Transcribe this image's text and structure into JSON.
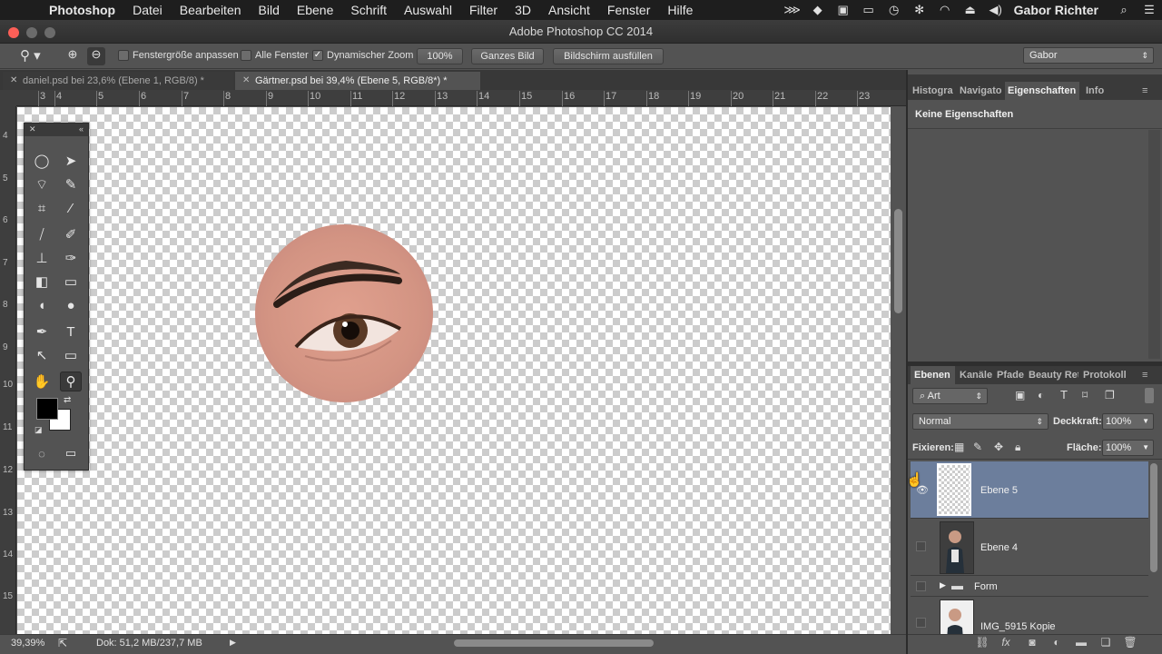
{
  "menubar": {
    "app": "Photoshop",
    "items": [
      "Datei",
      "Bearbeiten",
      "Bild",
      "Ebene",
      "Schrift",
      "Auswahl",
      "Filter",
      "3D",
      "Ansicht",
      "Fenster",
      "Hilfe"
    ],
    "user": "Gabor Richter"
  },
  "window": {
    "title": "Adobe Photoshop CC 2014"
  },
  "options": {
    "resize_windows": "Fenstergröße anpassen",
    "all_windows": "Alle Fenster",
    "scrubby_zoom": "Dynamischer Zoom",
    "zoom_value": "100%",
    "fit_screen": "Ganzes Bild",
    "fill_screen": "Bildschirm ausfüllen",
    "workspace": "Gabor"
  },
  "tabs": [
    {
      "label": "daniel.psd bei 23,6% (Ebene 1, RGB/8) *"
    },
    {
      "label": "Gärtner.psd bei 39,4% (Ebene 5, RGB/8*) *"
    }
  ],
  "rulers": {
    "top": [
      "3",
      "4",
      "5",
      "6",
      "7",
      "8",
      "9",
      "10",
      "11",
      "12",
      "13",
      "14",
      "15",
      "16",
      "17",
      "18",
      "19",
      "20",
      "21",
      "22",
      "23"
    ],
    "left": [
      "4",
      "5",
      "6",
      "7",
      "8",
      "9",
      "10",
      "11",
      "12",
      "13",
      "14",
      "15"
    ]
  },
  "status": {
    "zoom": "39,39%",
    "doc": "Dok: 51,2 MB/237,7 MB"
  },
  "properties_panel": {
    "tabs": [
      "Histogra",
      "Navigato",
      "Eigenschaften",
      "Info"
    ],
    "empty_text": "Keine Eigenschaften"
  },
  "layers_panel": {
    "tabs": [
      "Ebenen",
      "Kanäle",
      "Pfade",
      "Beauty Ret",
      "Protokoll"
    ],
    "filter_kind": "Art",
    "blend_mode": "Normal",
    "opacity_label": "Deckkraft:",
    "opacity": "100%",
    "lock_label": "Fixieren:",
    "fill_label": "Fläche:",
    "fill": "100%",
    "layers": [
      {
        "name": "Ebene 5",
        "visible": true,
        "selected": true
      },
      {
        "name": "Ebene 4",
        "visible": false,
        "selected": false
      },
      {
        "name": "Form",
        "visible": false,
        "selected": false,
        "group": true
      },
      {
        "name": "IMG_5915 Kopie",
        "visible": false,
        "selected": false
      }
    ]
  }
}
